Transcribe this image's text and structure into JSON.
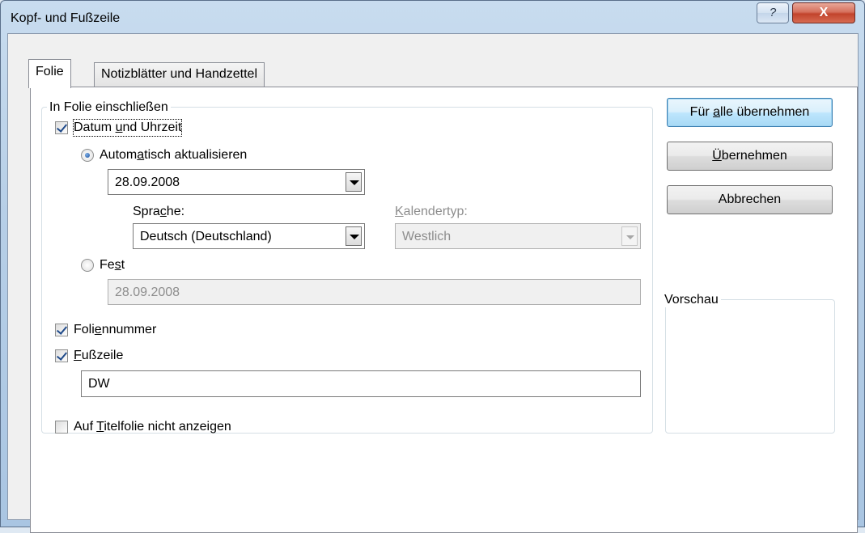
{
  "window": {
    "title": "Kopf- und Fußzeile",
    "help_symbol": "?",
    "close_symbol": "X"
  },
  "tabs": [
    {
      "label": "Folie",
      "active": true
    },
    {
      "label": "Notizblätter und Handzettel",
      "active": false
    }
  ],
  "include_group": {
    "legend": "In Folie einschließen",
    "datetime": {
      "label_parts": [
        "Datum ",
        "u",
        "nd Uhrzeit"
      ],
      "checked": true,
      "auto_update": {
        "label_parts": [
          "Autom",
          "a",
          "tisch aktualisieren"
        ],
        "selected": true,
        "date_value": "28.09.2008",
        "language_label_parts": [
          "Spra",
          "c",
          "he:"
        ],
        "language_value": "Deutsch (Deutschland)",
        "calendar_label_parts": [
          "",
          "K",
          "alendertyp:"
        ],
        "calendar_value": "Westlich"
      },
      "fixed": {
        "label_parts": [
          "Fe",
          "s",
          "t"
        ],
        "selected": false,
        "value": "28.09.2008"
      }
    },
    "slide_number": {
      "label_parts": [
        "Foli",
        "e",
        "nnummer"
      ],
      "checked": true
    },
    "footer": {
      "label_parts": [
        "",
        "F",
        "ußzeile"
      ],
      "checked": true,
      "value": "DW"
    }
  },
  "dont_show_on_title": {
    "label_parts": [
      "Auf ",
      "T",
      "itelfolie nicht anzeigen"
    ],
    "checked": false
  },
  "buttons": {
    "apply_all": {
      "parts": [
        "Für ",
        "a",
        "lle übernehmen"
      ]
    },
    "apply": {
      "parts": [
        "",
        "Ü",
        "bernehmen"
      ]
    },
    "cancel": {
      "label": "Abbrechen"
    }
  },
  "preview": {
    "legend": "Vorschau"
  },
  "colors": {
    "default_button": "#bee6fd",
    "check_mark": "#1f4a8a",
    "disabled_text": "#8d8d8d"
  }
}
